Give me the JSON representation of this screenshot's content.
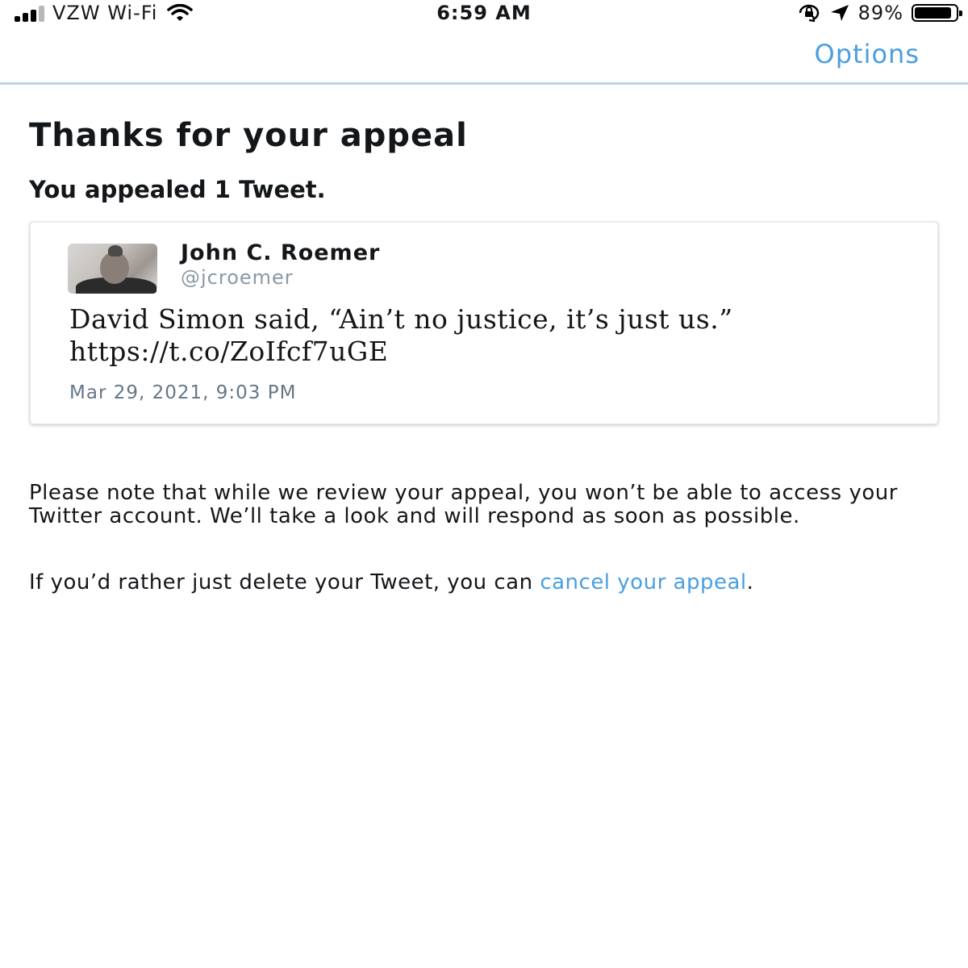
{
  "status_bar": {
    "carrier": "VZW Wi-Fi",
    "time": "6:59 AM",
    "battery_percent": "89%",
    "battery_level": 0.89,
    "signal_bars": 3,
    "icons": [
      "wifi-icon",
      "orientation-lock-icon",
      "location-arrow-icon",
      "battery-icon"
    ]
  },
  "nav": {
    "options_label": "Options"
  },
  "page": {
    "title": "Thanks for your appeal",
    "subtitle": "You appealed 1 Tweet."
  },
  "tweet": {
    "author_name": "John C. Roemer",
    "author_handle": "@jcroemer",
    "text": "David Simon said, “Ain’t no justice, it’s just us.” https://t.co/ZoIfcf7uGE",
    "date": "Mar 29, 2021, 9:03 PM"
  },
  "note": {
    "text": "Please note that while we review your appeal, you won’t be able to access your Twitter account. We’ll take a look and will respond as soon as possible.",
    "cancel_prefix": "If you’d rather just delete your Tweet, you can ",
    "cancel_link": "cancel your appeal",
    "cancel_suffix": "."
  },
  "colors": {
    "link": "#4a9fe0",
    "nav_border": "#b6d6ee",
    "handle_gray": "#8899a6"
  }
}
